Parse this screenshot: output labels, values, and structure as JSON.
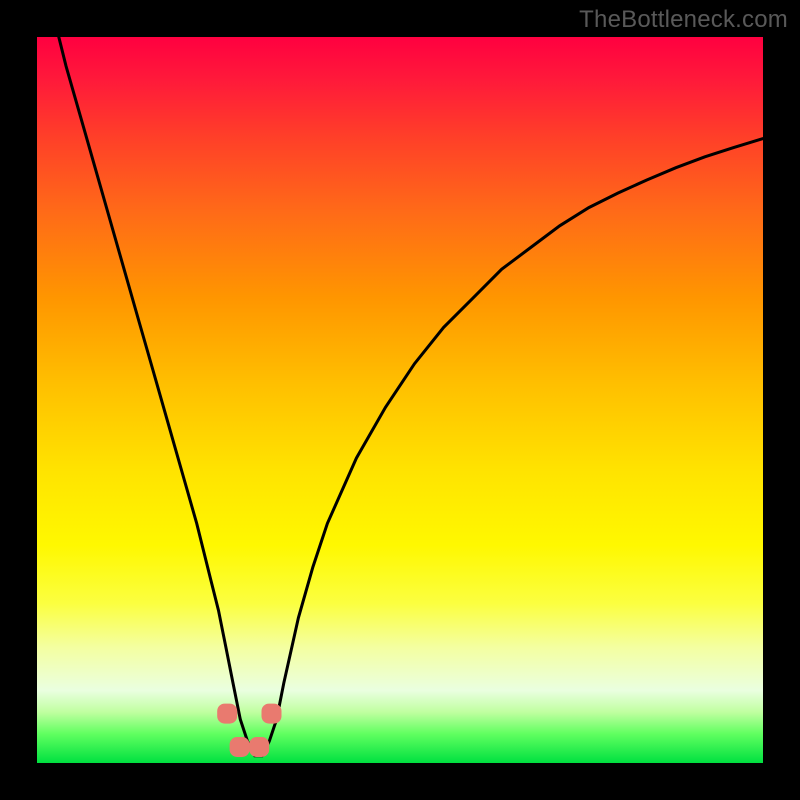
{
  "watermark": "TheBottleneck.com",
  "colors": {
    "background": "#000000",
    "curve_stroke": "#000000",
    "marker_fill": "#e97a6f",
    "gradient_stops": [
      "#ff0040",
      "#ff1a3a",
      "#ff4028",
      "#ff6a18",
      "#ff9600",
      "#ffc000",
      "#ffe400",
      "#fff800",
      "#fbff40",
      "#f4ffa0",
      "#eaffe0",
      "#c0ffa0",
      "#60ff60",
      "#00e040"
    ]
  },
  "chart_data": {
    "type": "line",
    "title": "",
    "xlabel": "",
    "ylabel": "",
    "xlim": [
      0,
      100
    ],
    "ylim": [
      0,
      100
    ],
    "grid": false,
    "legend": false,
    "series": [
      {
        "name": "bottleneck-curve",
        "comment": "x in [0,100] normalized horizontal position; y is bottleneck percentage where 0=bottom(green/good) and 100=top(red/bad). Values estimated from pixel positions.",
        "x": [
          3,
          4,
          6,
          8,
          10,
          12,
          14,
          16,
          18,
          20,
          22,
          24,
          25,
          26,
          27,
          28,
          29,
          30,
          31,
          32,
          33,
          34,
          36,
          38,
          40,
          44,
          48,
          52,
          56,
          60,
          64,
          68,
          72,
          76,
          80,
          84,
          88,
          92,
          96,
          100
        ],
        "y": [
          100,
          96,
          89,
          82,
          75,
          68,
          61,
          54,
          47,
          40,
          33,
          25,
          21,
          16,
          11,
          6,
          3,
          1,
          1,
          3,
          6,
          11,
          20,
          27,
          33,
          42,
          49,
          55,
          60,
          64,
          68,
          71,
          74,
          76.5,
          78.5,
          80.3,
          82,
          83.5,
          84.8,
          86
        ]
      }
    ],
    "markers": {
      "comment": "Salmon-colored rounded markers near the curve minimum in the green band.",
      "points": [
        {
          "x": 26.2,
          "y": 6.8
        },
        {
          "x": 27.9,
          "y": 2.2
        },
        {
          "x": 30.6,
          "y": 2.2
        },
        {
          "x": 32.3,
          "y": 6.8
        }
      ],
      "radius_px": 10
    }
  }
}
